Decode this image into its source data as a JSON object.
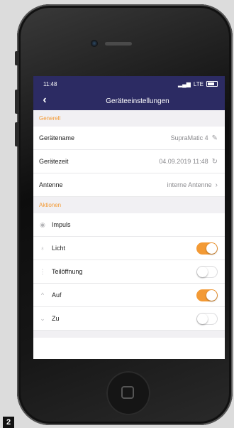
{
  "status": {
    "time": "11:48",
    "network": "LTE"
  },
  "nav": {
    "back_icon": "chevron-left-icon",
    "title": "Geräteeinstellungen"
  },
  "sections": {
    "general": "Generell",
    "actions": "Aktionen"
  },
  "general": [
    {
      "label": "Gerätename",
      "value": "SupraMatic 4",
      "icon": "pencil-icon"
    },
    {
      "label": "Gerätezeit",
      "value": "04.09.2019 11:48",
      "icon": "refresh-icon"
    },
    {
      "label": "Antenne",
      "value": "interne Antenne",
      "icon": "chevron-right-icon"
    }
  ],
  "actions": [
    {
      "label": "Impuls",
      "icon": "impulse-icon"
    },
    {
      "label": "Licht",
      "icon": "bulb-icon",
      "enabled": true
    },
    {
      "label": "Teilöffnung",
      "icon": "partial-open-icon",
      "enabled": false
    },
    {
      "label": "Auf",
      "icon": "chevron-up-icon",
      "enabled": true
    },
    {
      "label": "Zu",
      "icon": "chevron-down-icon",
      "enabled": false
    }
  ],
  "colors": {
    "header": "#2c2b63",
    "accent": "#f39a35",
    "section_bg": "#f1f0f3"
  },
  "figure_number": "2"
}
